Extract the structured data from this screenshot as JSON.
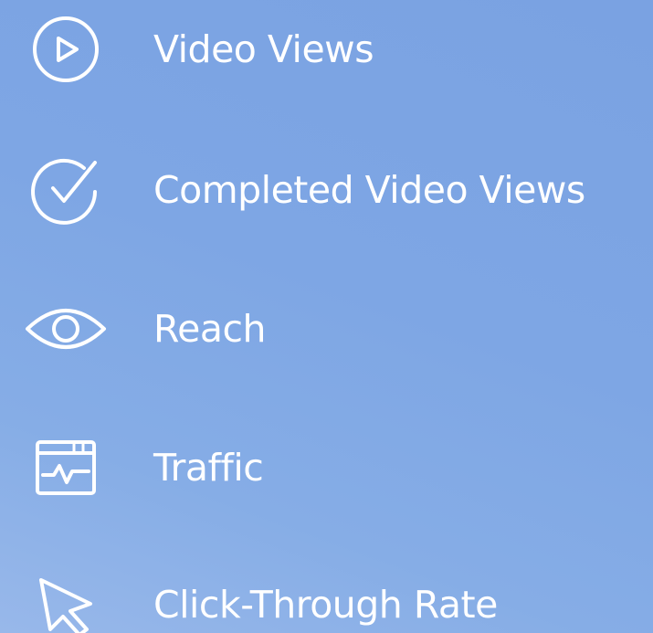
{
  "metrics": [
    {
      "label": "Video Views",
      "icon": "play-circle-icon"
    },
    {
      "label": "Completed Video Views",
      "icon": "check-circle-icon"
    },
    {
      "label": "Reach",
      "icon": "eye-icon"
    },
    {
      "label": "Traffic",
      "icon": "browser-chart-icon"
    },
    {
      "label": "Click-Through Rate",
      "icon": "cursor-pointer-icon"
    }
  ],
  "colors": {
    "text": "#ffffff",
    "icon_stroke": "#ffffff",
    "background_start": "#7aa2e2",
    "background_end": "#98b8ea"
  }
}
